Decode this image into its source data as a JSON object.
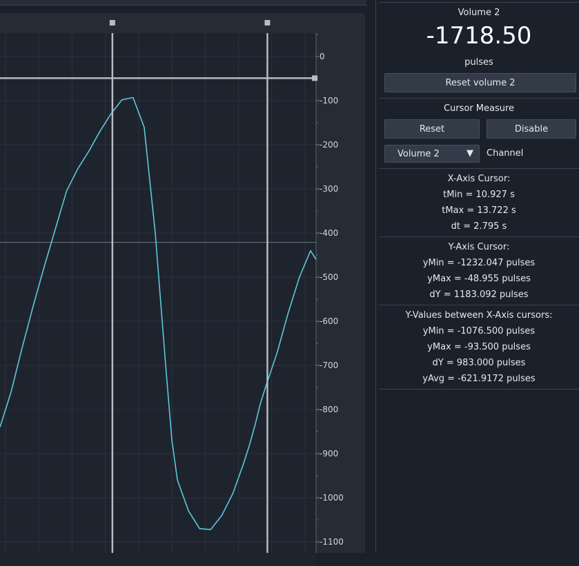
{
  "channel_value": {
    "title": "Volume 2",
    "value": "-1718.50",
    "unit": "pulses",
    "reset_button": "Reset volume 2"
  },
  "cursor_measure": {
    "title": "Cursor Measure",
    "reset_button": "Reset",
    "disable_button": "Disable",
    "channel_select_value": "Volume 2",
    "channel_label": "Channel"
  },
  "x_cursor": {
    "heading": "X-Axis Cursor:",
    "tmin": "tMin = 10.927 s",
    "tmax": "tMax = 13.722 s",
    "dt": "dt = 2.795 s"
  },
  "y_cursor": {
    "heading": "Y-Axis Cursor:",
    "ymin": "yMin = -1232.047 pulses",
    "ymax": "yMax = -48.955 pulses",
    "dy": "dY = 1183.092 pulses"
  },
  "y_between": {
    "heading": "Y-Values between X-Axis cursors:",
    "ymin": "yMin = -1076.500 pulses",
    "ymax": "yMax = -93.500 pulses",
    "dy": "dY = 983.000 pulses",
    "yavg": "yAvg = -621.9172 pulses"
  },
  "colors": {
    "trace": "#5ec8dd",
    "cursor": "#b9bcc0",
    "background": "#1b212b"
  },
  "chart_data": {
    "type": "line",
    "y_ticks": [
      0,
      -100,
      -200,
      -300,
      -400,
      -500,
      -600,
      -700,
      -800,
      -900,
      -1000,
      -1100
    ],
    "y_tick_labels": [
      "0",
      "-100",
      "-200",
      "-300",
      "-400",
      "-500",
      "-600",
      "-700",
      "-800",
      "-900",
      "-1000",
      "-1100"
    ],
    "ylim": [
      -1110,
      80
    ],
    "xlim": [
      8.9,
      14.6
    ],
    "grid": true,
    "x_cursors": [
      10.927,
      13.722
    ],
    "y_cursor": -48.955,
    "series": [
      {
        "x": [
          8.9,
          9.1,
          9.3,
          9.5,
          9.7,
          9.9,
          10.1,
          10.3,
          10.5,
          10.7,
          10.9,
          11.1,
          11.3,
          11.5,
          11.7,
          11.8,
          11.9,
          12.0,
          12.1,
          12.3,
          12.5,
          12.7,
          12.9,
          13.1,
          13.3,
          13.4,
          13.5,
          13.6,
          13.7,
          13.9,
          14.1,
          14.3,
          14.5,
          14.6
        ],
        "y": [
          -840,
          -760,
          -660,
          -565,
          -475,
          -390,
          -305,
          -255,
          -215,
          -170,
          -130,
          -98,
          -93,
          -160,
          -400,
          -560,
          -720,
          -870,
          -960,
          -1030,
          -1070,
          -1072,
          -1040,
          -990,
          -920,
          -880,
          -835,
          -785,
          -745,
          -670,
          -580,
          -500,
          -440,
          -460
        ]
      }
    ]
  }
}
